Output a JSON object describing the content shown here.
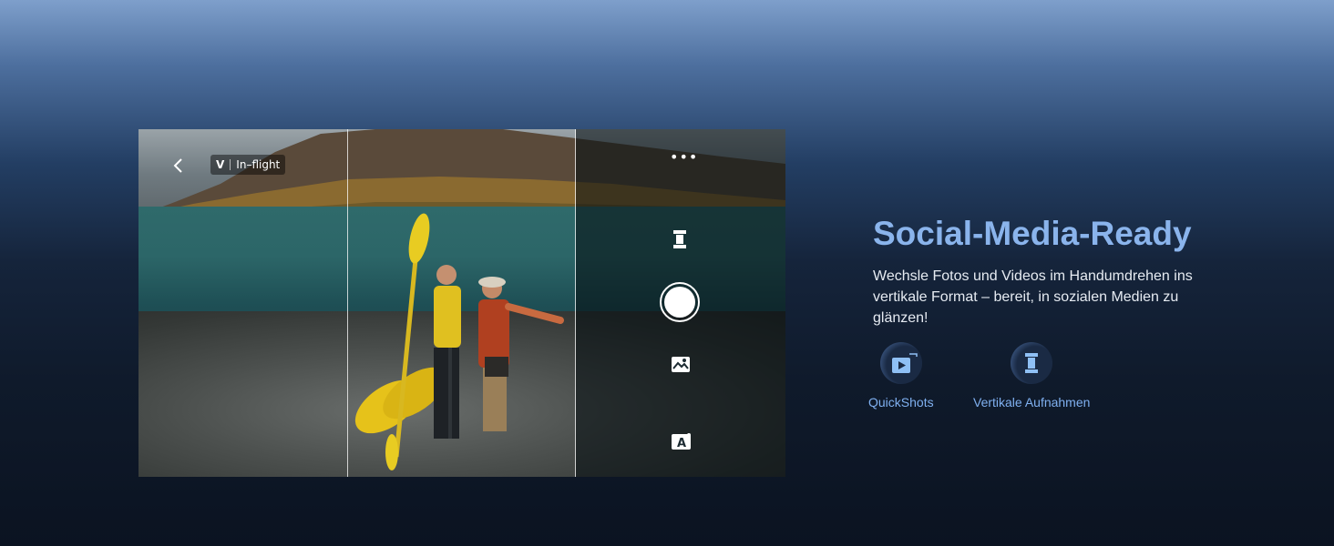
{
  "camera_ui": {
    "back_icon": "chevron-left-icon",
    "mode_badge": "V",
    "mode_label": "In–flight",
    "more_icon": "more-dots-icon",
    "more_glyph": "•••",
    "vertical_icon": "vertical-shot-icon",
    "shutter_icon": "shutter-button",
    "gallery_icon": "gallery-icon",
    "text_mode_icon": "auto-text-icon",
    "text_mode_glyph": "A"
  },
  "content": {
    "title": "Social-Media-Ready",
    "description": "Wechsle Fotos und Videos im Handumdrehen ins vertikale Format – bereit, in sozialen Medien zu glänzen!",
    "features": [
      {
        "label": "QuickShots",
        "icon": "quickshots-icon"
      },
      {
        "label": "Vertikale Aufnahmen",
        "icon": "vertical-shooting-icon"
      }
    ]
  },
  "colors": {
    "title": "#8ab4ec",
    "feature_label": "#7fb0f0",
    "background_top": "#7e9fcb",
    "background_bottom": "#0b1321"
  }
}
